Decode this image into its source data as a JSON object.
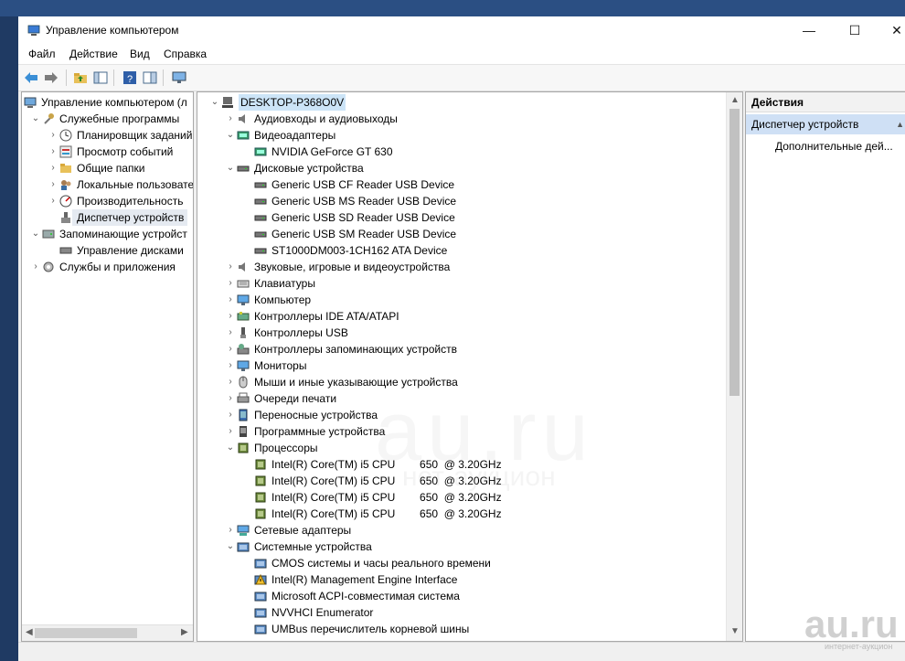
{
  "window": {
    "title": "Управление компьютером",
    "controls": [
      "minimize-icon",
      "maximize-icon",
      "close-icon"
    ]
  },
  "menu": [
    "Файл",
    "Действие",
    "Вид",
    "Справка"
  ],
  "toolbar": [
    "back-icon",
    "forward-icon",
    "up-folder-icon",
    "show-hide-tree-icon",
    "help-icon",
    "properties-icon",
    "monitor-icon"
  ],
  "left_tree": [
    {
      "label": "Управление компьютером (л",
      "level": 0,
      "chev": "",
      "icon": "computer-mgmt-icon"
    },
    {
      "label": "Служебные программы",
      "level": 1,
      "chev": "down",
      "icon": "tools-icon"
    },
    {
      "label": "Планировщик заданий",
      "level": 2,
      "chev": "right",
      "icon": "clock-icon"
    },
    {
      "label": "Просмотр событий",
      "level": 2,
      "chev": "right",
      "icon": "event-viewer-icon"
    },
    {
      "label": "Общие папки",
      "level": 2,
      "chev": "right",
      "icon": "shared-folder-icon"
    },
    {
      "label": "Локальные пользовате",
      "level": 2,
      "chev": "right",
      "icon": "users-icon"
    },
    {
      "label": "Производительность",
      "level": 2,
      "chev": "right",
      "icon": "performance-icon"
    },
    {
      "label": "Диспетчер устройств",
      "level": 2,
      "chev": "",
      "icon": "device-manager-icon",
      "selected": true
    },
    {
      "label": "Запоминающие устройст",
      "level": 1,
      "chev": "down",
      "icon": "storage-icon"
    },
    {
      "label": "Управление дисками",
      "level": 2,
      "chev": "",
      "icon": "disk-mgmt-icon"
    },
    {
      "label": "Службы и приложения",
      "level": 1,
      "chev": "right",
      "icon": "services-icon"
    }
  ],
  "device_tree": [
    {
      "label": "DESKTOP-P368O0V",
      "level": 0,
      "chev": "down",
      "icon": "computer-icon",
      "highlight": true
    },
    {
      "label": "Аудиовходы и аудиовыходы",
      "level": 1,
      "chev": "right",
      "icon": "speaker-icon"
    },
    {
      "label": "Видеоадаптеры",
      "level": 1,
      "chev": "down",
      "icon": "display-adapter-icon"
    },
    {
      "label": "NVIDIA GeForce GT 630",
      "level": 2,
      "chev": "",
      "icon": "display-adapter-icon"
    },
    {
      "label": "Дисковые устройства",
      "level": 1,
      "chev": "down",
      "icon": "disk-drive-icon"
    },
    {
      "label": "Generic USB CF Reader USB Device",
      "level": 2,
      "chev": "",
      "icon": "disk-drive-icon"
    },
    {
      "label": "Generic USB MS Reader USB Device",
      "level": 2,
      "chev": "",
      "icon": "disk-drive-icon"
    },
    {
      "label": "Generic USB SD Reader USB Device",
      "level": 2,
      "chev": "",
      "icon": "disk-drive-icon"
    },
    {
      "label": "Generic USB SM Reader USB Device",
      "level": 2,
      "chev": "",
      "icon": "disk-drive-icon"
    },
    {
      "label": "ST1000DM003-1CH162 ATA Device",
      "level": 2,
      "chev": "",
      "icon": "disk-drive-icon"
    },
    {
      "label": "Звуковые, игровые и видеоустройства",
      "level": 1,
      "chev": "right",
      "icon": "speaker-icon"
    },
    {
      "label": "Клавиатуры",
      "level": 1,
      "chev": "right",
      "icon": "keyboard-icon"
    },
    {
      "label": "Компьютер",
      "level": 1,
      "chev": "right",
      "icon": "monitor-icon"
    },
    {
      "label": "Контроллеры IDE ATA/ATAPI",
      "level": 1,
      "chev": "right",
      "icon": "ide-controller-icon"
    },
    {
      "label": "Контроллеры USB",
      "level": 1,
      "chev": "right",
      "icon": "usb-icon"
    },
    {
      "label": "Контроллеры запоминающих устройств",
      "level": 1,
      "chev": "right",
      "icon": "storage-controller-icon"
    },
    {
      "label": "Мониторы",
      "level": 1,
      "chev": "right",
      "icon": "monitor-icon"
    },
    {
      "label": "Мыши и иные указывающие устройства",
      "level": 1,
      "chev": "right",
      "icon": "mouse-icon"
    },
    {
      "label": "Очереди печати",
      "level": 1,
      "chev": "right",
      "icon": "printer-icon"
    },
    {
      "label": "Переносные устройства",
      "level": 1,
      "chev": "right",
      "icon": "portable-device-icon"
    },
    {
      "label": "Программные устройства",
      "level": 1,
      "chev": "right",
      "icon": "software-device-icon"
    },
    {
      "label": "Процессоры",
      "level": 1,
      "chev": "down",
      "icon": "cpu-icon"
    },
    {
      "label": "Intel(R) Core(TM) i5 CPU        650  @ 3.20GHz",
      "level": 2,
      "chev": "",
      "icon": "cpu-icon"
    },
    {
      "label": "Intel(R) Core(TM) i5 CPU        650  @ 3.20GHz",
      "level": 2,
      "chev": "",
      "icon": "cpu-icon"
    },
    {
      "label": "Intel(R) Core(TM) i5 CPU        650  @ 3.20GHz",
      "level": 2,
      "chev": "",
      "icon": "cpu-icon"
    },
    {
      "label": "Intel(R) Core(TM) i5 CPU        650  @ 3.20GHz",
      "level": 2,
      "chev": "",
      "icon": "cpu-icon"
    },
    {
      "label": "Сетевые адаптеры",
      "level": 1,
      "chev": "right",
      "icon": "network-adapter-icon"
    },
    {
      "label": "Системные устройства",
      "level": 1,
      "chev": "down",
      "icon": "system-device-icon"
    },
    {
      "label": "CMOS системы и часы реального времени",
      "level": 2,
      "chev": "",
      "icon": "system-device-icon"
    },
    {
      "label": "Intel(R) Management Engine Interface",
      "level": 2,
      "chev": "",
      "icon": "warning-device-icon"
    },
    {
      "label": "Microsoft ACPI-совместимая система",
      "level": 2,
      "chev": "",
      "icon": "system-device-icon"
    },
    {
      "label": "NVVHCI Enumerator",
      "level": 2,
      "chev": "",
      "icon": "system-device-icon"
    },
    {
      "label": "UMBus перечислитель корневой шины",
      "level": 2,
      "chev": "",
      "icon": "system-device-icon"
    }
  ],
  "actions": {
    "header": "Действия",
    "section": "Диспетчер устройств",
    "more": "Дополнительные дей..."
  },
  "watermark": {
    "text": "au.ru",
    "sub": "нет-аукцион",
    "logo": "au.ru",
    "logo_sub": "интернет-аукцион"
  },
  "colors": {
    "selection": "#e5eaf1",
    "highlight": "#cce4f7",
    "actions_selected": "#cfe0f5"
  }
}
